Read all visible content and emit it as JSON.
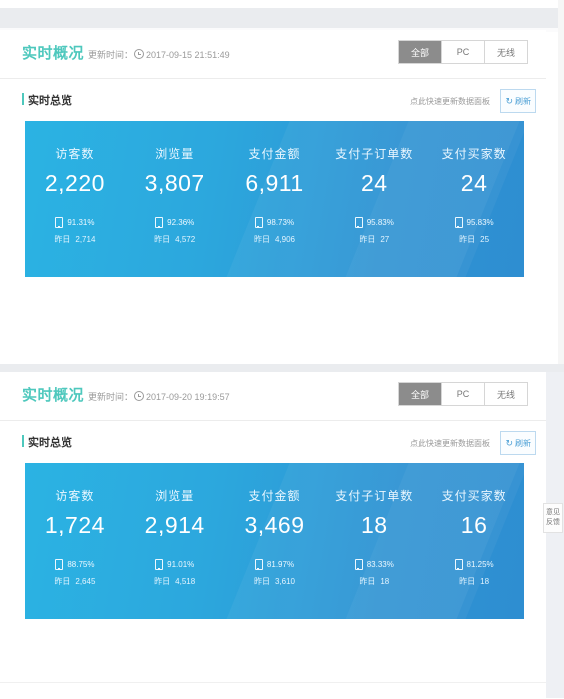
{
  "page": {
    "feedback_tab": "意见反馈"
  },
  "panels": [
    {
      "header": {
        "title": "实时概况",
        "update_label": "更新时间：",
        "update_time": "2017-09-15 21:51:49",
        "clock_icon": "clock-icon",
        "segments": [
          {
            "label": "全部",
            "active": true
          },
          {
            "label": "PC",
            "active": false
          },
          {
            "label": "无线",
            "active": false
          }
        ]
      },
      "sub": {
        "title": "实时总览",
        "hint": "点此快速更新数据面板",
        "refresh_label": "刷新",
        "refresh_icon": "refresh-icon"
      },
      "metrics": [
        {
          "label": "访客数",
          "value": "2,220",
          "pct": "91.31%",
          "prev_label": "昨日",
          "prev_value": "2,714",
          "device_icon": "mobile-phone-icon"
        },
        {
          "label": "浏览量",
          "value": "3,807",
          "pct": "92.36%",
          "prev_label": "昨日",
          "prev_value": "4,572",
          "device_icon": "mobile-phone-icon"
        },
        {
          "label": "支付金额",
          "value": "6,911",
          "pct": "98.73%",
          "prev_label": "昨日",
          "prev_value": "4,906",
          "device_icon": "mobile-phone-icon"
        },
        {
          "label": "支付子订单数",
          "value": "24",
          "pct": "95.83%",
          "prev_label": "昨日",
          "prev_value": "27",
          "device_icon": "mobile-phone-icon"
        },
        {
          "label": "支付买家数",
          "value": "24",
          "pct": "95.83%",
          "prev_label": "昨日",
          "prev_value": "25",
          "device_icon": "mobile-phone-icon"
        }
      ]
    },
    {
      "header": {
        "title": "实时概况",
        "update_label": "更新时间：",
        "update_time": "2017-09-20 19:19:57",
        "clock_icon": "clock-icon",
        "segments": [
          {
            "label": "全部",
            "active": true
          },
          {
            "label": "PC",
            "active": false
          },
          {
            "label": "无线",
            "active": false
          }
        ]
      },
      "sub": {
        "title": "实时总览",
        "hint": "点此快速更新数据面板",
        "refresh_label": "刷新",
        "refresh_icon": "refresh-icon"
      },
      "metrics": [
        {
          "label": "访客数",
          "value": "1,724",
          "pct": "88.75%",
          "prev_label": "昨日",
          "prev_value": "2,645",
          "device_icon": "mobile-phone-icon"
        },
        {
          "label": "浏览量",
          "value": "2,914",
          "pct": "91.01%",
          "prev_label": "昨日",
          "prev_value": "4,518",
          "device_icon": "mobile-phone-icon"
        },
        {
          "label": "支付金额",
          "value": "3,469",
          "pct": "81.97%",
          "prev_label": "昨日",
          "prev_value": "3,610",
          "device_icon": "mobile-phone-icon"
        },
        {
          "label": "支付子订单数",
          "value": "18",
          "pct": "83.33%",
          "prev_label": "昨日",
          "prev_value": "18",
          "device_icon": "mobile-phone-icon"
        },
        {
          "label": "支付买家数",
          "value": "16",
          "pct": "81.25%",
          "prev_label": "昨日",
          "prev_value": "18",
          "device_icon": "mobile-phone-icon"
        }
      ]
    }
  ],
  "colors": {
    "title_teal": "#4ec8bd",
    "panel_blue_light": "#2bb3e3",
    "panel_blue_dark": "#2e8ed1",
    "segment_active_bg": "#8c8c8c",
    "refresh_blue": "#4b9fd5"
  }
}
